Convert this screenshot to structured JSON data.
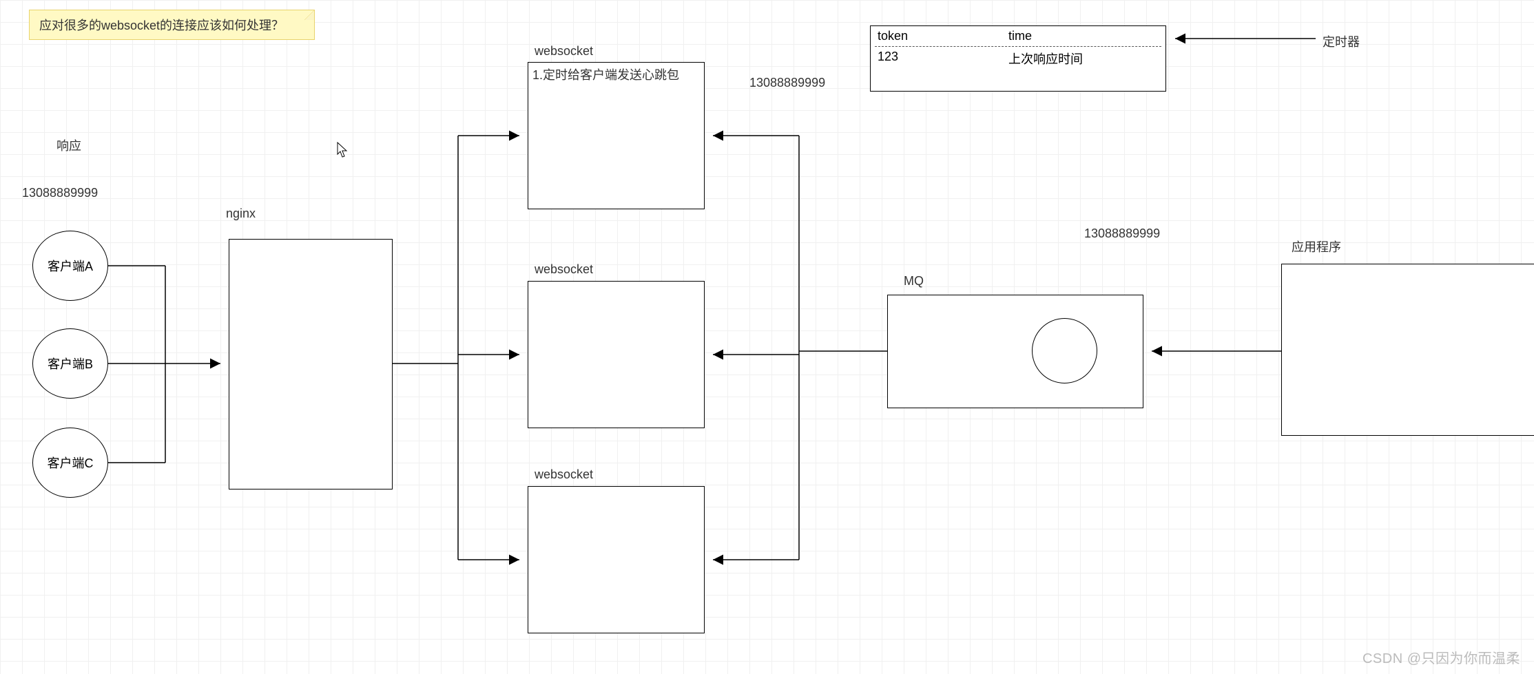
{
  "note": {
    "text": "应对很多的websocket的连接应该如何处理？"
  },
  "labels": {
    "response": "响应",
    "phone_left": "13088889999",
    "phone_top": "13088889999",
    "phone_mq": "13088889999",
    "nginx": "nginx",
    "websocket1": "websocket",
    "websocket2": "websocket",
    "websocket3": "websocket",
    "mq": "MQ",
    "app": "应用程序",
    "timer": "定时器"
  },
  "clients": {
    "a": "客户端A",
    "b": "客户端B",
    "c": "客户端C"
  },
  "ws1_text": "1.定时给客户端发送心跳包",
  "table": {
    "h1": "token",
    "h2": "time",
    "v1": "123",
    "v2": "上次响应时间"
  },
  "watermark": "CSDN @只因为你而温柔"
}
